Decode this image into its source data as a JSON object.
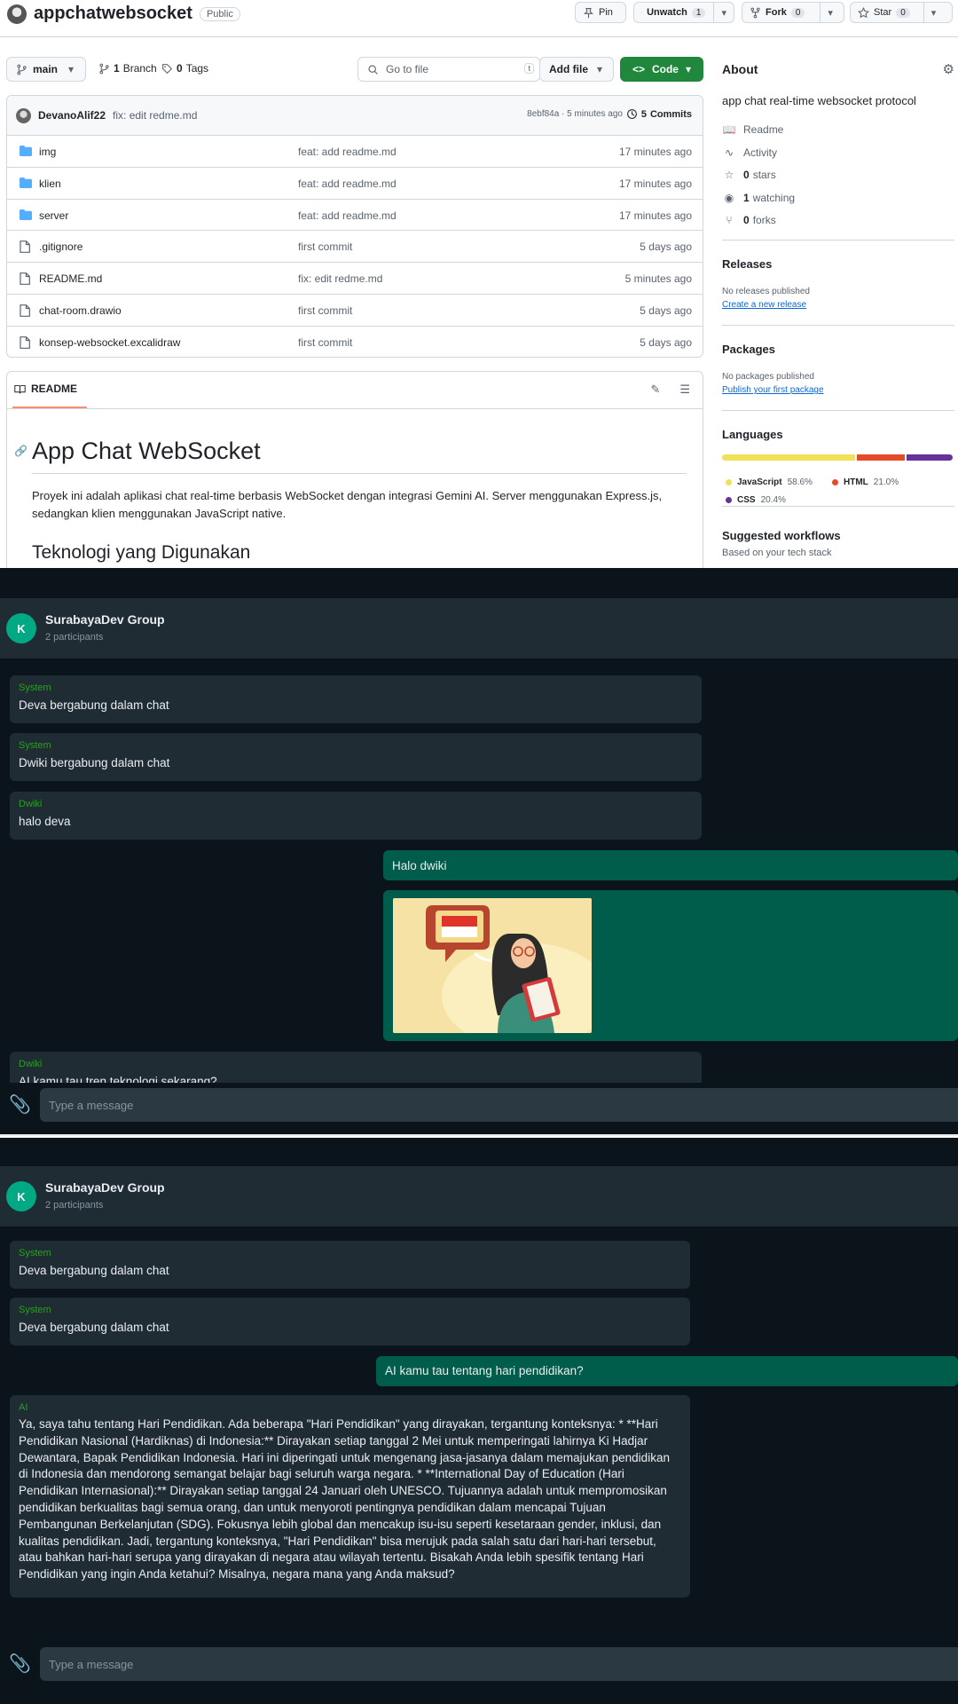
{
  "github": {
    "repo_name": "appchatwebsocket",
    "visibility": "Public",
    "pin_label": "Pin",
    "unwatch_label": "Unwatch",
    "unwatch_count": "1",
    "fork_label": "Fork",
    "fork_count": "0",
    "star_label": "Star",
    "star_count": "0",
    "branch_selector": "main",
    "branches_count": "1",
    "branches_label": "Branch",
    "tags_count": "0",
    "tags_label": "Tags",
    "go_to_file_placeholder": "Go to file",
    "go_to_file_kbd": "t",
    "add_file_label": "Add file",
    "code_label": "Code",
    "latest_commit": {
      "author": "DevanoAlif22",
      "message": "fix: edit redme.md",
      "meta": "8ebf84a · 5 minutes ago",
      "commits_count": "5",
      "commits_label": "Commits"
    },
    "files": [
      {
        "name": "img",
        "type": "folder",
        "commit": "feat: add readme.md",
        "date": "17 minutes ago"
      },
      {
        "name": "klien",
        "type": "folder",
        "commit": "feat: add readme.md",
        "date": "17 minutes ago"
      },
      {
        "name": "server",
        "type": "folder",
        "commit": "feat: add readme.md",
        "date": "17 minutes ago"
      },
      {
        "name": ".gitignore",
        "type": "file",
        "commit": "first commit",
        "date": "5 days ago"
      },
      {
        "name": "README.md",
        "type": "file",
        "commit": "fix: edit redme.md",
        "date": "5 minutes ago"
      },
      {
        "name": "chat-room.drawio",
        "type": "file",
        "commit": "first commit",
        "date": "5 days ago"
      },
      {
        "name": "konsep-websocket.excalidraw",
        "type": "file",
        "commit": "first commit",
        "date": "5 days ago"
      }
    ],
    "readme": {
      "tab_label": "README",
      "h1": "App Chat WebSocket",
      "paragraph": "Proyek ini adalah aplikasi chat real-time berbasis WebSocket dengan integrasi Gemini AI. Server menggunakan Express.js, sedangkan klien menggunakan JavaScript native.",
      "h2": "Teknologi yang Digunakan"
    },
    "about": {
      "title": "About",
      "description": "app chat real-time websocket protocol",
      "readme": "Readme",
      "activity": "Activity",
      "stars_count": "0",
      "stars_label": "stars",
      "watching_count": "1",
      "watching_label": "watching",
      "forks_count": "0",
      "forks_label": "forks"
    },
    "releases": {
      "title": "Releases",
      "empty": "No releases published",
      "link": "Create a new release"
    },
    "packages": {
      "title": "Packages",
      "empty": "No packages published",
      "link": "Publish your first package"
    },
    "languages": {
      "title": "Languages",
      "items": [
        {
          "name": "JavaScript",
          "percent": "58.6%",
          "value": 58.6,
          "color": "#f1e05a"
        },
        {
          "name": "HTML",
          "percent": "21.0%",
          "value": 21.0,
          "color": "#e34c26"
        },
        {
          "name": "CSS",
          "percent": "20.4%",
          "value": 20.4,
          "color": "#663399"
        }
      ]
    },
    "workflows": {
      "title": "Suggested workflows",
      "subtitle": "Based on your tech stack"
    }
  },
  "chat1": {
    "avatar_letter": "K",
    "group_name": "SurabayaDev Group",
    "participants": "2 participants",
    "messages": [
      {
        "sender": "System",
        "text": "Deva bergabung dalam chat"
      },
      {
        "sender": "System",
        "text": "Dwiki bergabung dalam chat"
      },
      {
        "sender": "Dwiki",
        "text": "halo deva"
      },
      {
        "sender": "",
        "text": "Halo dwiki"
      },
      {
        "sender": "Dwiki",
        "text": "AI kamu tau tren teknologi sekarang?"
      }
    ],
    "input_placeholder": "Type a message"
  },
  "chat2": {
    "avatar_letter": "K",
    "group_name": "SurabayaDev Group",
    "participants": "2 participants",
    "messages": [
      {
        "sender": "System",
        "text": "Deva bergabung dalam chat"
      },
      {
        "sender": "System",
        "text": "Deva bergabung dalam chat"
      },
      {
        "sender": "",
        "text": "AI kamu tau tentang hari pendidikan?"
      },
      {
        "sender": "AI",
        "text": "Ya, saya tahu tentang Hari Pendidikan. Ada beberapa \"Hari Pendidikan\" yang dirayakan, tergantung konteksnya: * **Hari Pendidikan Nasional (Hardiknas) di Indonesia:** Dirayakan setiap tanggal 2 Mei untuk memperingati lahirnya Ki Hadjar Dewantara, Bapak Pendidikan Indonesia. Hari ini diperingati untuk mengenang jasa-jasanya dalam memajukan pendidikan di Indonesia dan mendorong semangat belajar bagi seluruh warga negara. * **International Day of Education (Hari Pendidikan Internasional):** Dirayakan setiap tanggal 24 Januari oleh UNESCO. Tujuannya adalah untuk mempromosikan pendidikan berkualitas bagi semua orang, dan untuk menyoroti pentingnya pendidikan dalam mencapai Tujuan Pembangunan Berkelanjutan (SDG). Fokusnya lebih global dan mencakup isu-isu seperti kesetaraan gender, inklusi, dan kualitas pendidikan. Jadi, tergantung konteksnya, \"Hari Pendidikan\" bisa merujuk pada salah satu dari hari-hari tersebut, atau bahkan hari-hari serupa yang dirayakan di negara atau wilayah tertentu. Bisakah Anda lebih spesifik tentang Hari Pendidikan yang ingin Anda ketahui? Misalnya, negara mana yang Anda maksud?"
      }
    ],
    "input_placeholder": "Type a message"
  },
  "colors": {
    "chat_bg": "#0b141a",
    "incoming_bubble": "#202c33",
    "outgoing_bubble": "#005c4b",
    "sender_name": "#25a319",
    "avatar": "#00a884",
    "github_primary": "#1f883d",
    "link": "#0969da"
  }
}
